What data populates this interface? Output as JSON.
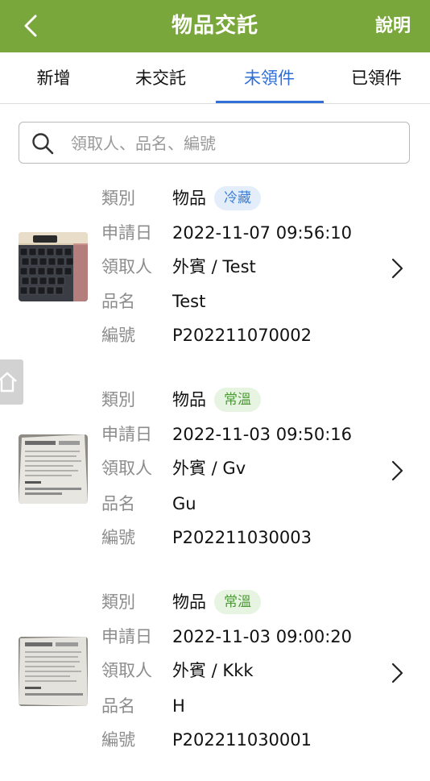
{
  "header": {
    "title": "物品交託",
    "help_label": "說明"
  },
  "tabs": [
    {
      "label": "新增"
    },
    {
      "label": "未交託"
    },
    {
      "label": "未領件",
      "active": true
    },
    {
      "label": "已領件"
    }
  ],
  "search": {
    "placeholder": "領取人、品名、編號",
    "value": ""
  },
  "labels": {
    "category": "類別",
    "date": "申請日",
    "recipient": "領取人",
    "item_name": "品名",
    "number": "編號"
  },
  "items": [
    {
      "category": "物品",
      "tag": "冷藏",
      "date": "2022-11-07 09:56:10",
      "recipient": "外賓 / Test",
      "item_name": "Test",
      "number": "P202211070002",
      "thumbnail": "keyboard-photo"
    },
    {
      "category": "物品",
      "tag": "常溫",
      "date": "2022-11-03 09:50:16",
      "recipient": "外賓 / Gv",
      "item_name": "Gu",
      "number": "P202211030003",
      "thumbnail": "book-page-photo"
    },
    {
      "category": "物品",
      "tag": "常溫",
      "date": "2022-11-03 09:00:20",
      "recipient": "外賓 / Kkk",
      "item_name": "H",
      "number": "P202211030001",
      "thumbnail": "book-page-photo"
    }
  ],
  "colors": {
    "header_green": "#7aa73b",
    "active_tab_blue": "#2f6fd6",
    "badge_cold_text": "#3d7fd6",
    "badge_normal_text": "#4c9a35"
  }
}
